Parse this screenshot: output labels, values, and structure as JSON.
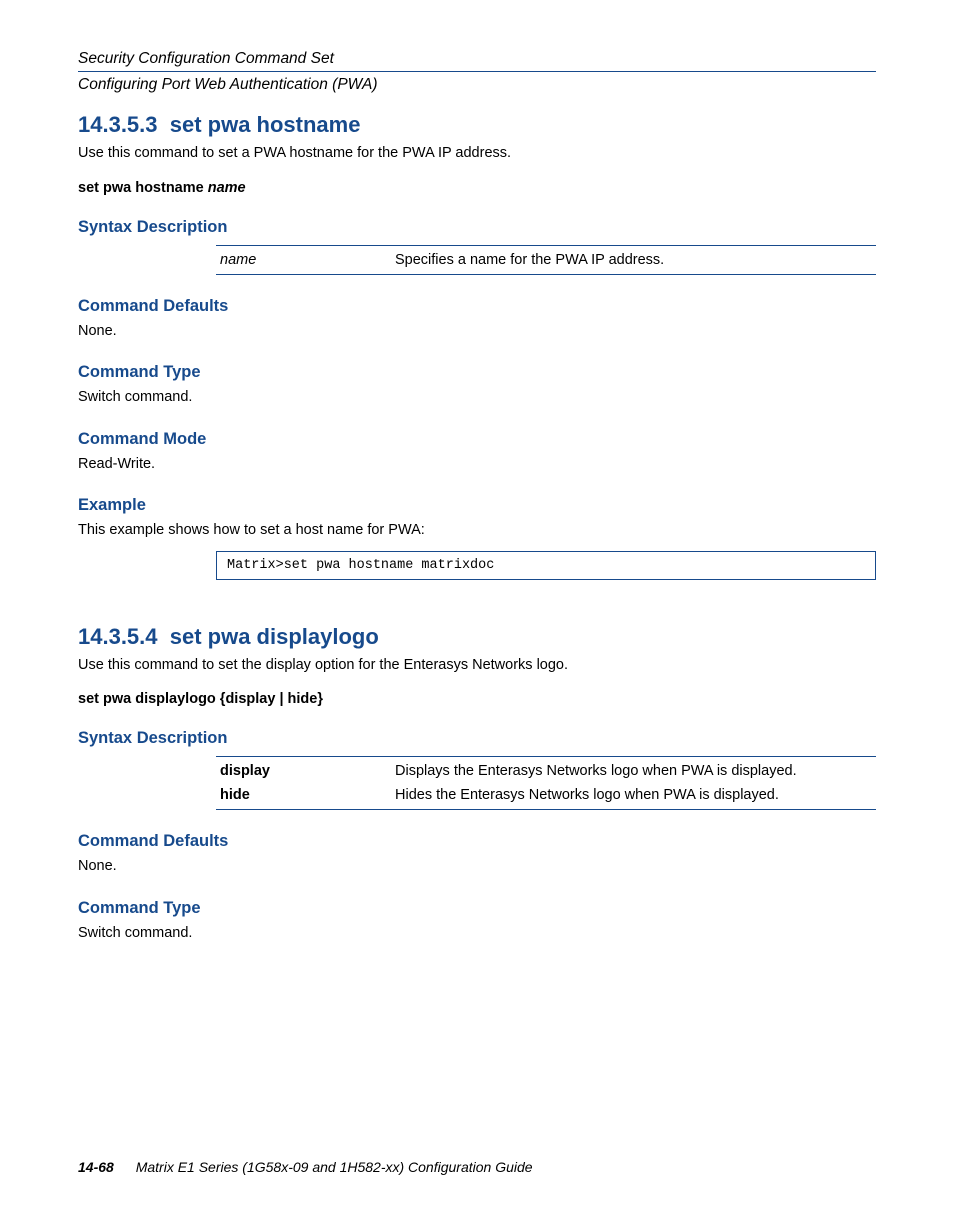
{
  "header": {
    "line1": "Security Configuration Command Set",
    "line2": "Configuring Port Web Authentication (PWA)"
  },
  "section1": {
    "number": "14.3.5.3",
    "title": "set pwa hostname",
    "desc": "Use this command to set a PWA hostname for the PWA IP address.",
    "syntax": "set pwa hostname name",
    "syntax_desc_label": "Syntax Description",
    "param_name": "name",
    "param_desc": "Specifies a name for the PWA IP address.",
    "defaults_label": "Command Defaults",
    "defaults_text": "None.",
    "type_label": "Command Type",
    "type_text": "Switch command.",
    "mode_label": "Command Mode",
    "mode_text": "Read-Write.",
    "example_label": "Example",
    "example_text": "This example shows how to set a host name for PWA:",
    "example_code": "Matrix>set pwa hostname matrixdoc"
  },
  "section2": {
    "number": "14.3.5.4",
    "title": "set pwa displaylogo",
    "desc": "Use this command to set the display option for the Enterasys Networks logo.",
    "syntax": "set pwa displaylogo {display | hide}",
    "syntax_desc_label": "Syntax Description",
    "opt1": "display",
    "opt1_desc": "Displays the Enterasys Networks logo when PWA is displayed.",
    "opt2": "hide",
    "opt2_desc": "Hides the Enterasys Networks logo when PWA is displayed.",
    "defaults_label": "Command Defaults",
    "defaults_text": "None.",
    "type_label": "Command Type",
    "type_text": "Switch command."
  },
  "footer": {
    "page_num": "14-68",
    "title": "Matrix E1 Series (1G58x-09 and 1H582-xx) Configuration Guide"
  }
}
